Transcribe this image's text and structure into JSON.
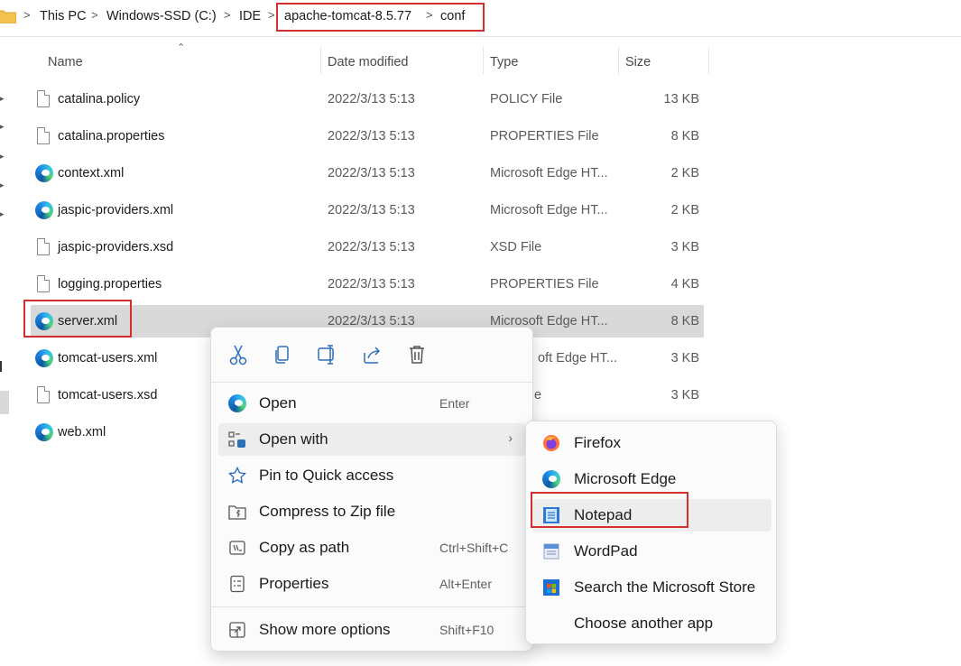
{
  "breadcrumb": {
    "items": [
      "This PC",
      "Windows-SSD (C:)",
      "IDE",
      "apache-tomcat-8.5.77",
      "conf"
    ],
    "separator": ">"
  },
  "columns": {
    "name": "Name",
    "date_modified": "Date modified",
    "type": "Type",
    "size": "Size"
  },
  "files": [
    {
      "name": "catalina.policy",
      "date": "2022/3/13 5:13",
      "type": "POLICY File",
      "size": "13 KB",
      "icon": "document-icon"
    },
    {
      "name": "catalina.properties",
      "date": "2022/3/13 5:13",
      "type": "PROPERTIES File",
      "size": "8 KB",
      "icon": "document-icon"
    },
    {
      "name": "context.xml",
      "date": "2022/3/13 5:13",
      "type": "Microsoft Edge HT...",
      "size": "2 KB",
      "icon": "edge-icon"
    },
    {
      "name": "jaspic-providers.xml",
      "date": "2022/3/13 5:13",
      "type": "Microsoft Edge HT...",
      "size": "2 KB",
      "icon": "edge-icon"
    },
    {
      "name": "jaspic-providers.xsd",
      "date": "2022/3/13 5:13",
      "type": "XSD File",
      "size": "3 KB",
      "icon": "document-icon"
    },
    {
      "name": "logging.properties",
      "date": "2022/3/13 5:13",
      "type": "PROPERTIES File",
      "size": "4 KB",
      "icon": "document-icon"
    },
    {
      "name": "server.xml",
      "date": "2022/3/13 5:13",
      "type": "Microsoft Edge HT...",
      "size": "8 KB",
      "icon": "edge-icon",
      "selected": true
    },
    {
      "name": "tomcat-users.xml",
      "date": "",
      "type": "oft Edge HT...",
      "size": "3 KB",
      "icon": "edge-icon"
    },
    {
      "name": "tomcat-users.xsd",
      "date": "",
      "type": "e",
      "size": "3 KB",
      "icon": "document-icon"
    },
    {
      "name": "web.xml",
      "date": "",
      "type": "",
      "size": "",
      "icon": "edge-icon"
    }
  ],
  "context_menu": {
    "quick_actions": [
      "cut-icon",
      "copy-icon",
      "rename-icon",
      "share-icon",
      "delete-icon"
    ],
    "items": [
      {
        "label": "Open",
        "shortcut": "Enter",
        "icon": "edge-icon"
      },
      {
        "label": "Open with",
        "shortcut": "",
        "icon": "open-with-icon",
        "submenu": true
      },
      {
        "label": "Pin to Quick access",
        "shortcut": "",
        "icon": "star-icon"
      },
      {
        "label": "Compress to Zip file",
        "shortcut": "",
        "icon": "zip-icon"
      },
      {
        "label": "Copy as path",
        "shortcut": "Ctrl+Shift+C",
        "icon": "copy-path-icon"
      },
      {
        "label": "Properties",
        "shortcut": "Alt+Enter",
        "icon": "properties-icon"
      },
      {
        "label": "Show more options",
        "shortcut": "Shift+F10",
        "icon": "more-options-icon"
      }
    ]
  },
  "open_with_menu": {
    "items": [
      {
        "label": "Firefox",
        "icon": "firefox-icon"
      },
      {
        "label": "Microsoft Edge",
        "icon": "edge-icon"
      },
      {
        "label": "Notepad",
        "icon": "notepad-icon",
        "highlighted": true
      },
      {
        "label": "WordPad",
        "icon": "wordpad-icon"
      },
      {
        "label": "Search the Microsoft Store",
        "icon": "store-icon"
      },
      {
        "label": "Choose another app",
        "icon": ""
      }
    ]
  },
  "colors": {
    "highlight_box": "#d32f2f",
    "selected_row": "#d9d9d9",
    "menu_hover": "#ededed",
    "accent": "#2d6fb7"
  }
}
